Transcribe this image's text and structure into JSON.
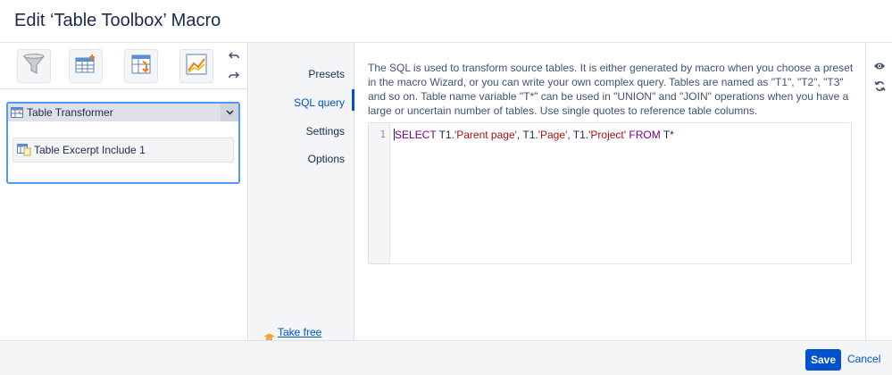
{
  "dialog": {
    "title": "Edit ‘Table Toolbox’ Macro"
  },
  "toolbar": {
    "buttons": [
      {
        "icon": "filter-funnel-icon"
      },
      {
        "icon": "table-add-icon"
      },
      {
        "icon": "table-transform-icon"
      },
      {
        "icon": "chart-line-icon"
      }
    ],
    "undo_icon": "undo-icon",
    "redo_icon": "redo-icon"
  },
  "macro_tree": {
    "parent": {
      "label": "Table Transformer",
      "icon": "table-transformer-icon"
    },
    "child": {
      "label": "Table Excerpt Include 1",
      "icon": "table-excerpt-icon"
    }
  },
  "nav": {
    "items": [
      {
        "label": "Presets",
        "active": false
      },
      {
        "label": "SQL query",
        "active": true
      },
      {
        "label": "Settings",
        "active": false
      },
      {
        "label": "Options",
        "active": false
      }
    ],
    "course_link": "Take free course"
  },
  "sql": {
    "description": "The SQL is used to transform source tables. It is either generated by macro when you choose a preset in the macro Wizard, or you can write your own complex query. Tables are named as \"T1\", \"T2\", \"T3\" and so on. Table name variable \"T*\" can be used in \"UNION\" and \"JOIN\" operations when you have a large or uncertain number of tables. Use single quotes to reference table columns.",
    "line_number": "1",
    "code": {
      "kw_select": "SELECT",
      "t1a": "T1.",
      "col1": "'Parent page'",
      "sep1": ", T1.",
      "col2": "'Page'",
      "sep2": ", T1.",
      "col3": "'Project'",
      "kw_from": "FROM",
      "tail": "T*"
    }
  },
  "right_icons": [
    "eye-icon",
    "refresh-icon"
  ],
  "footer": {
    "save_label": "Save",
    "cancel_label": "Cancel"
  },
  "colors": {
    "accent": "#0052cc",
    "focus_border": "#4c9aff",
    "keyword": "#770088",
    "string": "#aa1111"
  }
}
